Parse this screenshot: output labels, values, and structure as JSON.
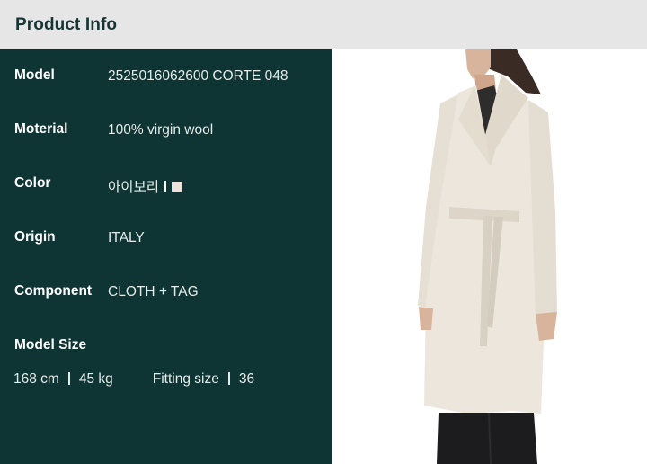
{
  "header": {
    "title": "Product Info"
  },
  "info": {
    "model": {
      "label": "Model",
      "value": "2525016062600 CORTE 048"
    },
    "material": {
      "label": "Moterial",
      "value": "100% virgin wool"
    },
    "color": {
      "label": "Color",
      "value": "아이보리",
      "swatch": "#e9e4de"
    },
    "origin": {
      "label": "Origin",
      "value": "ITALY"
    },
    "component": {
      "label": "Component",
      "value": "CLOTH + TAG"
    }
  },
  "model_size": {
    "label": "Model Size",
    "height": "168 cm",
    "weight": "45 kg",
    "fitting_label": "Fitting size",
    "fitting_value": "36"
  },
  "colors": {
    "header_bg": "#e6e6e6",
    "header_text": "#173534",
    "panel_bg": "#0f3434",
    "coat": "#ece6dc"
  }
}
